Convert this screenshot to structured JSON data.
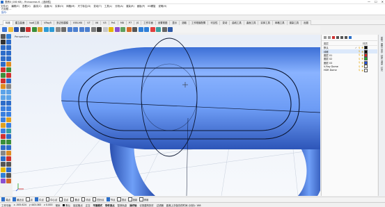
{
  "titlebar": {
    "title": "表情0 (160 KB) - Rhinoceros 6 - [选用性]",
    "minimize": "—",
    "maximize": "☐",
    "close": "✕"
  },
  "menubar": {
    "items": [
      "文件(F)",
      "编辑(E)",
      "查看(V)",
      "曲线(C)",
      "曲面(S)",
      "实体(O)",
      "网格(M)",
      "尺寸标注(D)",
      "变动(T)",
      "工具(L)",
      "分析(A)",
      "渲染(R)",
      "面板(P)",
      "KS螺旋",
      "说明(H)"
    ]
  },
  "command": {
    "history": [
      "已加载 ...",
      "指令:"
    ],
    "prompt": "指令:",
    "input_value": ""
  },
  "tabs": [
    "标准",
    "建立曲面",
    "Iso6工具",
    "VRay5",
    "多边形建模",
    "V5B-MX",
    "V7",
    "V6",
    "V5",
    "Pe1",
    "M8",
    "P7",
    "JS",
    "工作平面",
    "设置视图",
    "显示",
    "选取",
    "工作视窗配置",
    "可见性",
    "变动",
    "曲线工具",
    "曲面工具",
    "实体工具",
    "网格工具",
    "渲染工具",
    "出图"
  ],
  "active_tab": "标准",
  "viewport": {
    "label": "Perspective"
  },
  "layers": {
    "header": [
      "图层",
      "材质"
    ],
    "rows": [
      {
        "name": "默认",
        "check": "✓",
        "color": "#000000",
        "selected": false
      },
      {
        "name": "线框",
        "check": "",
        "color": "#000000",
        "selected": true
      },
      {
        "name": "图层 01",
        "check": "",
        "color": "#e02020",
        "selected": false
      },
      {
        "name": "图层 02",
        "check": "",
        "color": "#1ab02a",
        "selected": false
      },
      {
        "name": "图层 03",
        "check": "",
        "color": "#1f4fe0",
        "selected": false
      },
      {
        "name": "V-Ray Dome",
        "check": "",
        "color": "#ffffff",
        "selected": false
      },
      {
        "name": "HDR Dome",
        "check": "",
        "color": "#ffffff",
        "selected": false
      }
    ],
    "light_icon": "♀",
    "lock_icon": "🔓"
  },
  "right_vtabs": [
    "属性",
    "图层",
    "显示",
    "材质",
    "渲染",
    "灯光"
  ],
  "osnap": {
    "items": [
      {
        "label": "端点",
        "on": true
      },
      {
        "label": "最近点",
        "on": true
      },
      {
        "label": "点",
        "on": false
      },
      {
        "label": "中点",
        "on": true
      },
      {
        "label": "中心点",
        "on": false
      },
      {
        "label": "交点",
        "on": false
      },
      {
        "label": "垂点",
        "on": false
      },
      {
        "label": "切点",
        "on": false
      },
      {
        "label": "四分点",
        "on": false
      },
      {
        "label": "节点",
        "on": true
      },
      {
        "label": "顶点",
        "on": false
      },
      {
        "label": "投影",
        "on": false
      },
      {
        "label": "停用",
        "on": false
      }
    ]
  },
  "status": {
    "cplane": "工作平面",
    "x": "x -505.624",
    "y": "y 443.083",
    "z": "z 0.000",
    "units": "毫米",
    "layer": "默认",
    "toggles": [
      "锁定格点",
      "正交",
      "平面模式",
      "物件锁点",
      "智慧轨迹",
      "操作轴",
      "记录建构历史",
      "过滤器"
    ],
    "message": "距离上次保存的时间 (分钟): 188"
  },
  "colors": {
    "accent": "#2b6fc9",
    "surface": "#6e9cf3"
  }
}
